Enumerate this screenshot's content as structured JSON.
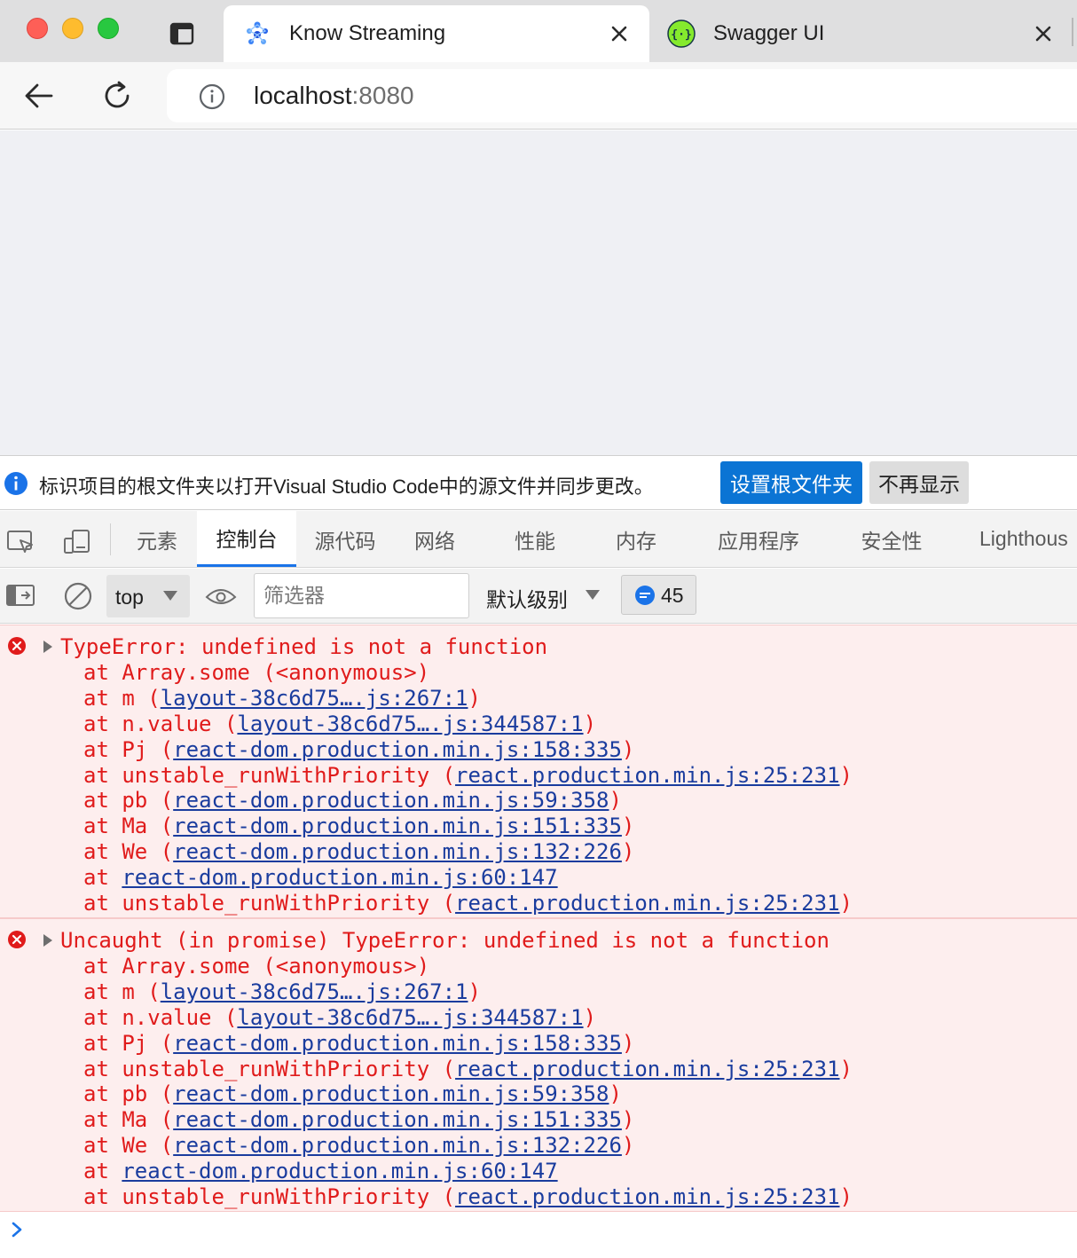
{
  "browser": {
    "tabs": [
      {
        "title": "Know Streaming",
        "favicon": "know-streaming-logo-icon",
        "active": true
      },
      {
        "title": "Swagger UI",
        "favicon": "swagger-logo-icon",
        "active": false
      }
    ],
    "url_host": "localhost",
    "url_port": ":8080"
  },
  "infobar": {
    "text": "标识项目的根文件夹以打开Visual Studio Code中的源文件并同步更改。",
    "primary_button": "设置根文件夹",
    "secondary_button": "不再显示"
  },
  "devtools": {
    "tabs": [
      "元素",
      "控制台",
      "源代码",
      "网络",
      "性能",
      "内存",
      "应用程序",
      "安全性",
      "Lighthous"
    ],
    "active_tab": "控制台"
  },
  "console_toolbar": {
    "context": "top",
    "filter_placeholder": "筛选器",
    "level": "默认级别",
    "issues_count": "45"
  },
  "messages": [
    {
      "head": "TypeError: undefined is not a function",
      "frames": [
        {
          "fn": "Array.some",
          "paren": "(<anonymous>)",
          "link": ""
        },
        {
          "fn": "m",
          "paren": "",
          "link": "layout-38c6d75….js:267:1"
        },
        {
          "fn": "n.value",
          "paren": "",
          "link": "layout-38c6d75….js:344587:1"
        },
        {
          "fn": "Pj",
          "paren": "",
          "link": "react-dom.production.min.js:158:335"
        },
        {
          "fn": "unstable_runWithPriority",
          "paren": "",
          "link": "react.production.min.js:25:231"
        },
        {
          "fn": "pb",
          "paren": "",
          "link": "react-dom.production.min.js:59:358"
        },
        {
          "fn": "Ma",
          "paren": "",
          "link": "react-dom.production.min.js:151:335"
        },
        {
          "fn": "We",
          "paren": "",
          "link": "react-dom.production.min.js:132:226"
        },
        {
          "fn": "",
          "paren": "",
          "link": "react-dom.production.min.js:60:147"
        },
        {
          "fn": "unstable_runWithPriority",
          "paren": "",
          "link": "react.production.min.js:25:231"
        }
      ]
    },
    {
      "head": "Uncaught (in promise) TypeError: undefined is not a function",
      "frames": [
        {
          "fn": "Array.some",
          "paren": "(<anonymous>)",
          "link": ""
        },
        {
          "fn": "m",
          "paren": "",
          "link": "layout-38c6d75….js:267:1"
        },
        {
          "fn": "n.value",
          "paren": "",
          "link": "layout-38c6d75….js:344587:1"
        },
        {
          "fn": "Pj",
          "paren": "",
          "link": "react-dom.production.min.js:158:335"
        },
        {
          "fn": "unstable_runWithPriority",
          "paren": "",
          "link": "react.production.min.js:25:231"
        },
        {
          "fn": "pb",
          "paren": "",
          "link": "react-dom.production.min.js:59:358"
        },
        {
          "fn": "Ma",
          "paren": "",
          "link": "react-dom.production.min.js:151:335"
        },
        {
          "fn": "We",
          "paren": "",
          "link": "react-dom.production.min.js:132:226"
        },
        {
          "fn": "",
          "paren": "",
          "link": "react-dom.production.min.js:60:147"
        },
        {
          "fn": "unstable_runWithPriority",
          "paren": "",
          "link": "react.production.min.js:25:231"
        }
      ]
    }
  ],
  "colors": {
    "accent": "#1a73e8",
    "error_text": "#e01b1b",
    "error_bg": "#fdeeee",
    "link": "#1a3c9e",
    "primary_button": "#0b74d4"
  }
}
